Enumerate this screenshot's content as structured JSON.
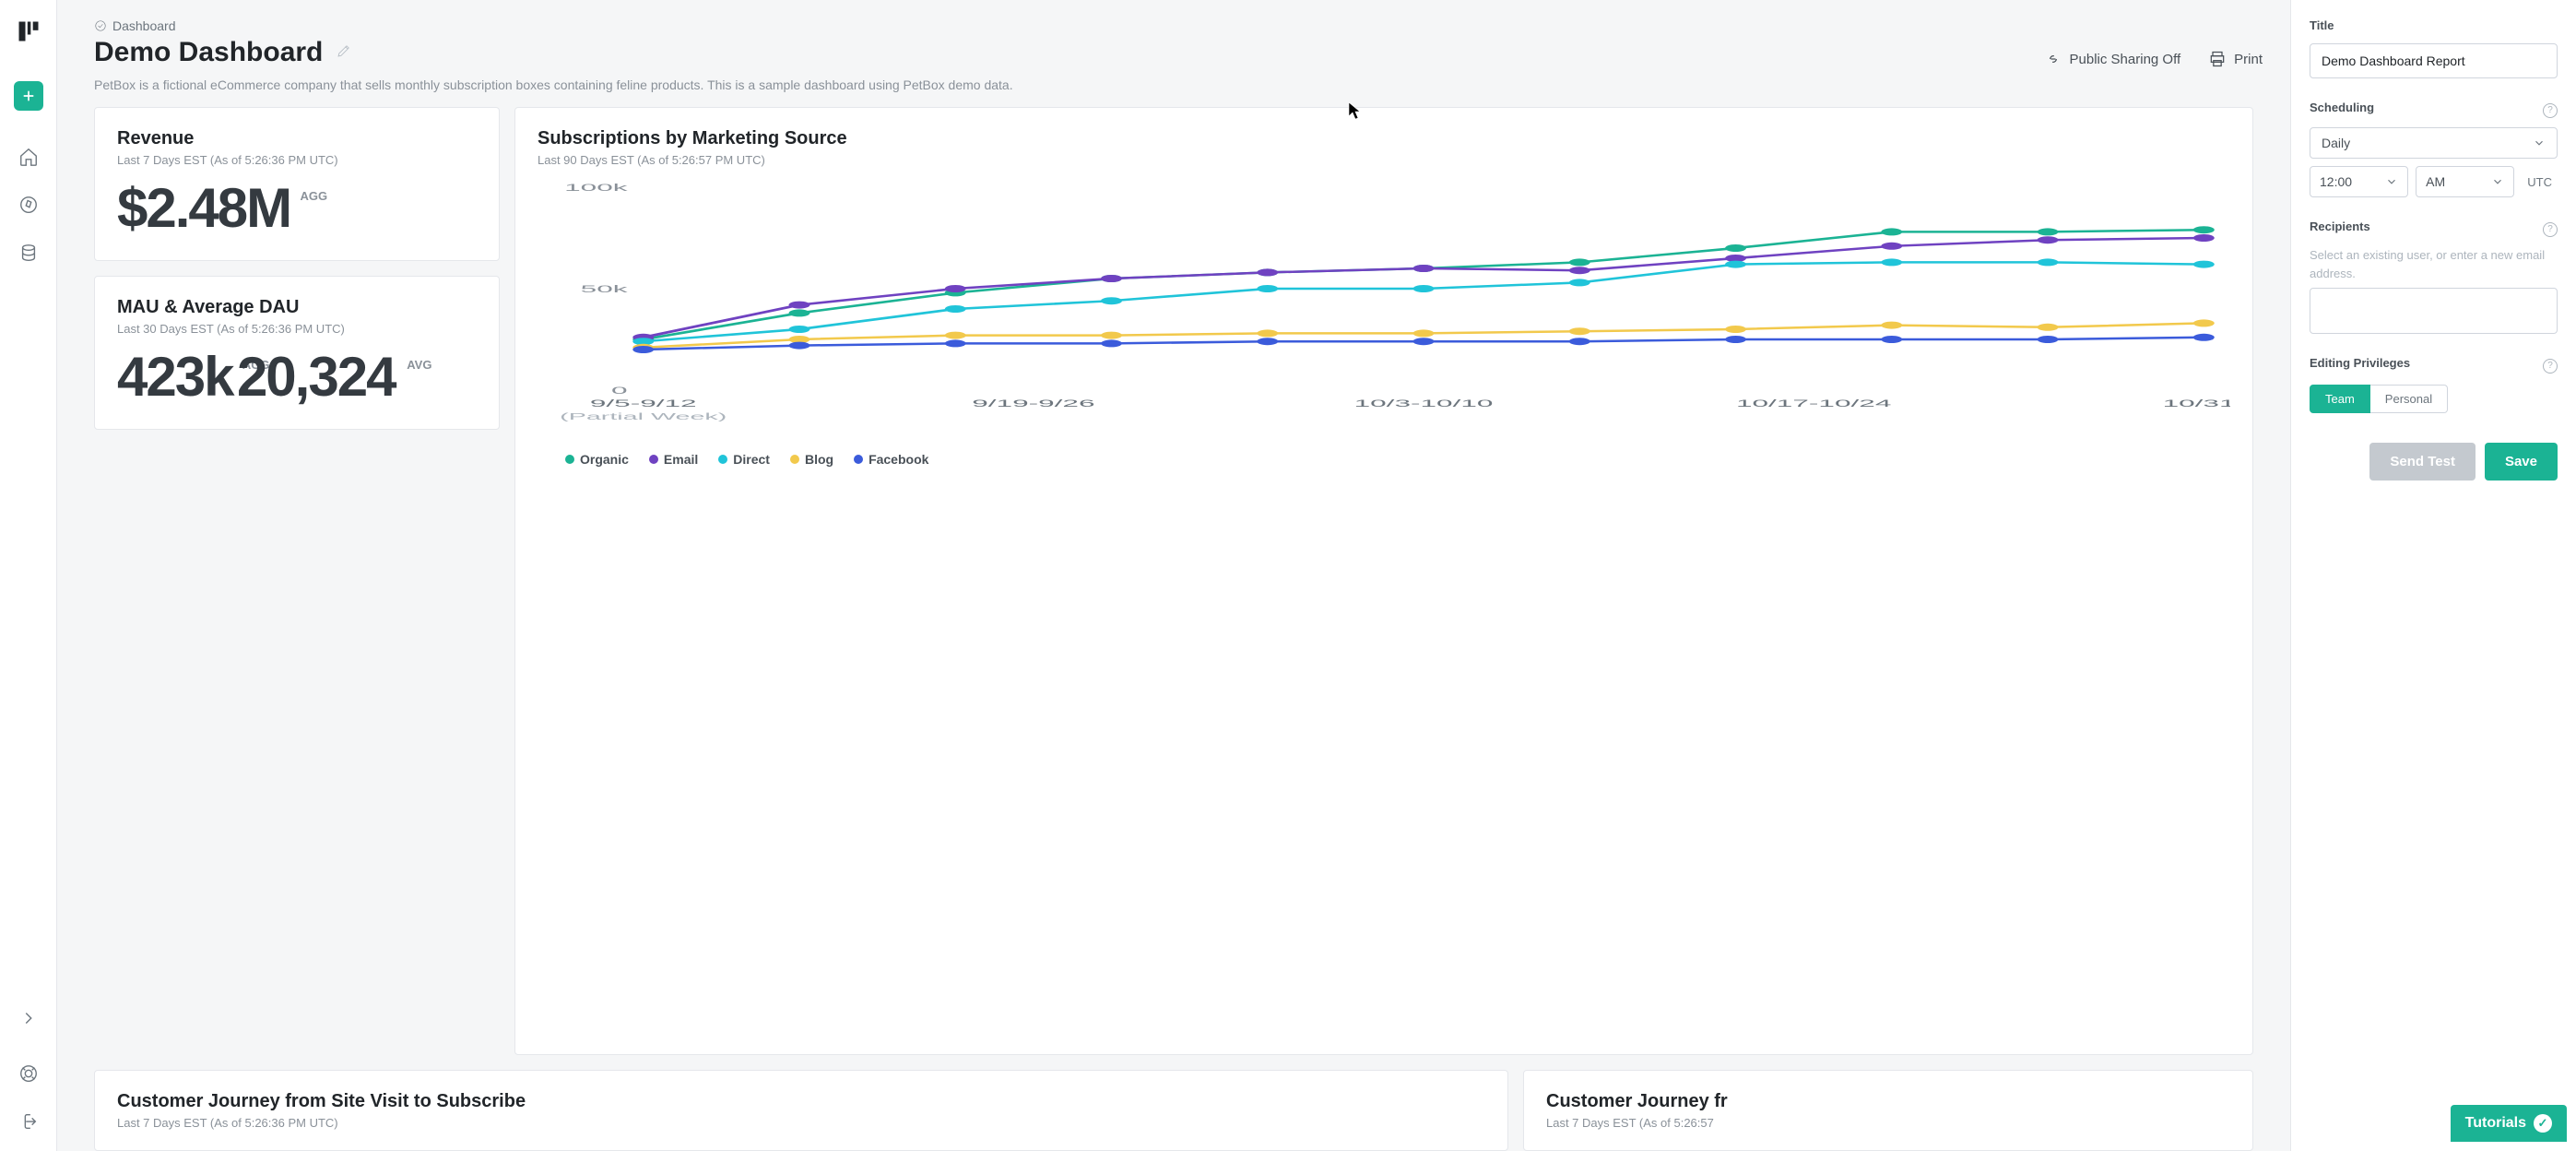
{
  "breadcrumb": {
    "label": "Dashboard"
  },
  "page": {
    "title": "Demo Dashboard",
    "description": "PetBox is a fictional eCommerce company that sells monthly subscription boxes containing feline products. This is a sample dashboard using PetBox demo data."
  },
  "header_actions": {
    "sharing": "Public Sharing Off",
    "print": "Print"
  },
  "cards": {
    "revenue": {
      "title": "Revenue",
      "sub": "Last 7 Days EST (As of 5:26:36 PM UTC)",
      "value": "$2.48M",
      "tag": "AGG"
    },
    "mau": {
      "title": "MAU & Average DAU",
      "sub": "Last 30 Days EST (As of 5:26:36 PM UTC)",
      "value1": "423k",
      "tag1": "AGG",
      "value2": "20,324",
      "tag2": "AVG"
    },
    "journey1": {
      "title": "Customer Journey from Site Visit to Subscribe",
      "sub": "Last 7 Days EST (As of 5:26:36 PM UTC)"
    },
    "journey2": {
      "title": "Customer Journey fr",
      "sub": "Last 7 Days EST (As of 5:26:57"
    },
    "subscriptions": {
      "title": "Subscriptions by Marketing Source",
      "sub": "Last 90 Days EST (As of 5:26:57 PM UTC)"
    }
  },
  "chart_data": {
    "type": "line",
    "title": "Subscriptions by Marketing Source",
    "ylabel": "",
    "ylim": [
      0,
      100000
    ],
    "yticks_labels": [
      "0",
      "50k",
      "100k"
    ],
    "categories": [
      "9/5-9/12",
      "9/19-9/26",
      "10/3-10/10",
      "10/17-10/24",
      "10/31-"
    ],
    "x_note": "(Partial Week)",
    "series": [
      {
        "name": "Organic",
        "color": "#1bb394",
        "values": [
          25000,
          38000,
          48000,
          55000,
          58000,
          60000,
          63000,
          70000,
          78000,
          78000,
          79000
        ]
      },
      {
        "name": "Email",
        "color": "#6f42c1",
        "values": [
          26000,
          42000,
          50000,
          55000,
          58000,
          60000,
          59000,
          65000,
          71000,
          74000,
          75000
        ]
      },
      {
        "name": "Direct",
        "color": "#20c4d9",
        "values": [
          24000,
          30000,
          40000,
          44000,
          50000,
          50000,
          53000,
          62000,
          63000,
          63000,
          62000
        ]
      },
      {
        "name": "Blog",
        "color": "#f2c94c",
        "values": [
          21000,
          25000,
          27000,
          27000,
          28000,
          28000,
          29000,
          30000,
          32000,
          31000,
          33000
        ]
      },
      {
        "name": "Facebook",
        "color": "#3b5bdb",
        "values": [
          20000,
          22000,
          23000,
          23000,
          24000,
          24000,
          24000,
          25000,
          25000,
          25000,
          26000
        ]
      }
    ]
  },
  "panel": {
    "title_label": "Title",
    "title_value": "Demo Dashboard Report",
    "scheduling_label": "Scheduling",
    "frequency": "Daily",
    "time": "12:00",
    "ampm": "AM",
    "tz": "UTC",
    "recipients_label": "Recipients",
    "recipients_placeholder": "Select an existing user, or enter a new email address.",
    "editing_label": "Editing Privileges",
    "team": "Team",
    "personal": "Personal",
    "send_test": "Send Test",
    "save": "Save"
  },
  "tutorials": "Tutorials"
}
